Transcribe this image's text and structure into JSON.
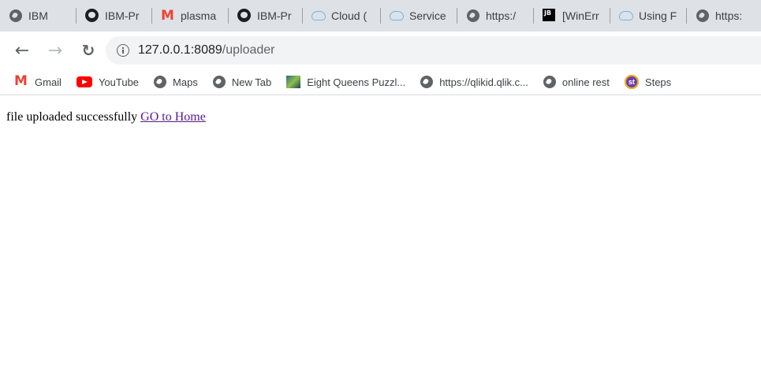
{
  "tabs": [
    {
      "title": "IBM",
      "icon": "globe-icon"
    },
    {
      "title": "IBM-Pr",
      "icon": "github-icon"
    },
    {
      "title": "plasma",
      "icon": "gmail-icon"
    },
    {
      "title": "IBM-Pr",
      "icon": "github-icon"
    },
    {
      "title": "Cloud (",
      "icon": "cloud-icon"
    },
    {
      "title": "Service",
      "icon": "cloud-icon"
    },
    {
      "title": "https:/",
      "icon": "globe-icon"
    },
    {
      "title": "[WinErr",
      "icon": "jetbrains-icon"
    },
    {
      "title": "Using F",
      "icon": "cloud-icon"
    },
    {
      "title": "https:",
      "icon": "globe-icon"
    }
  ],
  "toolbar": {
    "url_host": "127.0.0.1:8089",
    "url_path": "/uploader"
  },
  "bookmarks": [
    {
      "label": "Gmail",
      "icon": "gmail-icon"
    },
    {
      "label": "YouTube",
      "icon": "youtube-icon"
    },
    {
      "label": "Maps",
      "icon": "globe-icon"
    },
    {
      "label": "New Tab",
      "icon": "globe-icon"
    },
    {
      "label": "Eight Queens Puzzl...",
      "icon": "puzzle-icon"
    },
    {
      "label": "https://qlikid.qlik.c...",
      "icon": "globe-icon"
    },
    {
      "label": "online rest",
      "icon": "globe-icon"
    },
    {
      "label": "Steps",
      "icon": "steps-icon"
    }
  ],
  "page": {
    "message": "file uploaded successfully ",
    "link_text": "GO to Home"
  }
}
